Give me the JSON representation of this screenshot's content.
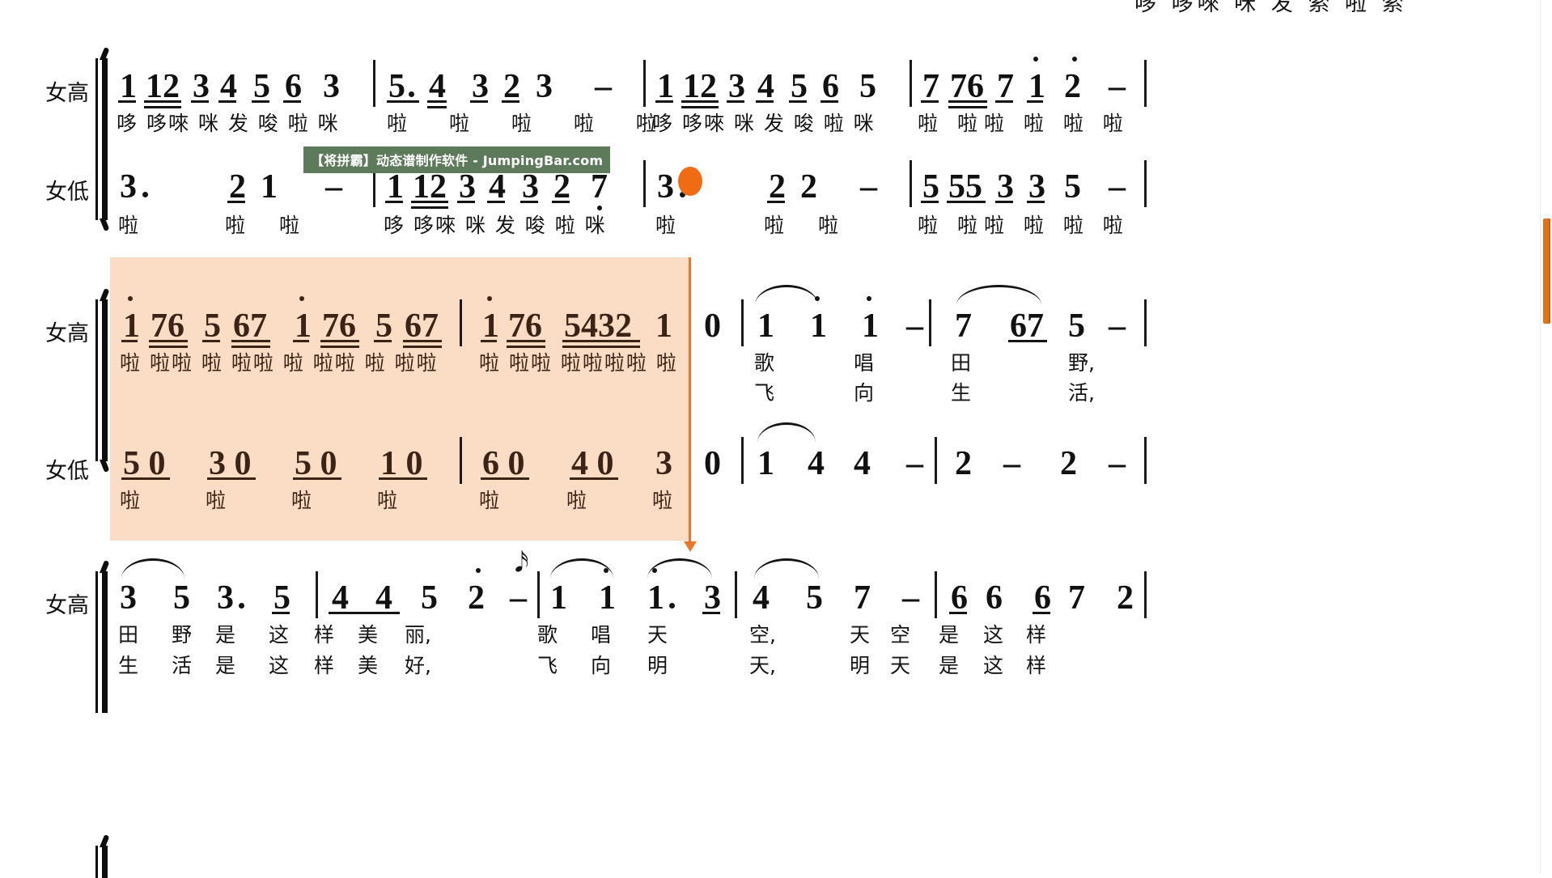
{
  "app": {
    "type": "jianpu-sheet-music-player",
    "watermark": "【将拼霸】动态谱制作软件 - JumpingBar.com",
    "highlight_color": "#fbdcc4",
    "cursor_color": "#e8762c",
    "playhead_color": "#ef6c14",
    "scrollbar_color": "#e0721c"
  },
  "partial_top_lyrics": "哆 哆唻 咪 发 索 啦 索",
  "systems": [
    {
      "id": "system-1",
      "highlighted": false,
      "staves": [
        {
          "part": "女高",
          "measures": [
            {
              "notes": "1 12 3 4 5 6 3",
              "lyrics": "哆 哆唻 咪 发 唆 啦 咪"
            },
            {
              "notes": "5· 4 3 2 3  -",
              "lyrics": "啦  啦 啦 啦 啦"
            },
            {
              "notes": "1 12 3 4 5 6 5",
              "lyrics": "哆 哆唻 咪 发 唆 啦 咪"
            },
            {
              "notes": "7 76 7 i 2̇ -",
              "lyrics": "啦 啦啦 啦 啦 啦"
            }
          ]
        },
        {
          "part": "女低",
          "measures": [
            {
              "notes": "3·   2 1   -",
              "lyrics": "啦   啦 啦"
            },
            {
              "notes": "1 12 3 4 3 2 7̣",
              "lyrics": "哆 哆唻 咪 发 唆 啦 咪"
            },
            {
              "notes": "3·   2 2   -",
              "lyrics": "啦   啦 啦"
            },
            {
              "notes": "5 55 3 3 5 -",
              "lyrics": "啦 啦啦 啦 啦 啦"
            }
          ]
        }
      ]
    },
    {
      "id": "system-2",
      "highlighted": true,
      "staves": [
        {
          "part": "女高",
          "measures": [
            {
              "notes": "i 76 5 67 i 76 5 67",
              "lyrics": "啦 啦啦 啦 啦啦 啦 啦啦 啦 啦啦"
            },
            {
              "notes": "i 76 5432 1  0",
              "lyrics": "啦 啦啦 啦啦啦啦 啦"
            },
            {
              "notes": "1 i i -",
              "lyrics_1": "歌 唱 田 野,",
              "lyrics_2": "飞 向 生 活,"
            },
            {
              "notes": "7 67 5 -",
              "lyrics_1": "",
              "lyrics_2": ""
            }
          ]
        },
        {
          "part": "女低",
          "measures": [
            {
              "notes": "5 0 3 0 5 0 1 0",
              "lyrics": "啦 啦 啦 啦"
            },
            {
              "notes": "6 0 4 0 3  0",
              "lyrics": "啦 啦 啦"
            },
            {
              "notes": "1 4 4 -",
              "lyrics": ""
            },
            {
              "notes": "2 - 2 -",
              "lyrics": ""
            }
          ]
        }
      ]
    },
    {
      "id": "system-3",
      "highlighted": false,
      "staves": [
        {
          "part": "女高",
          "measures": [
            {
              "notes": "3 5 3· 5",
              "lyrics_1": "田 野 是 这",
              "lyrics_2": "生 活 是 这"
            },
            {
              "notes": "4 4 5 2̇ -",
              "lyrics_1": "样 美 丽,",
              "lyrics_2": "样 美 好,"
            },
            {
              "notes": "1 i i· 3",
              "lyrics_1": "歌 唱 天",
              "lyrics_2": "飞 向 明"
            },
            {
              "notes": "4 5 7 -",
              "lyrics_1": "空,",
              "lyrics_2": "天,"
            },
            {
              "notes": "6 6 6 7 2",
              "lyrics_1": "天 空 是 这 样",
              "lyrics_2": "明 天 是 这 样"
            }
          ]
        }
      ]
    }
  ]
}
